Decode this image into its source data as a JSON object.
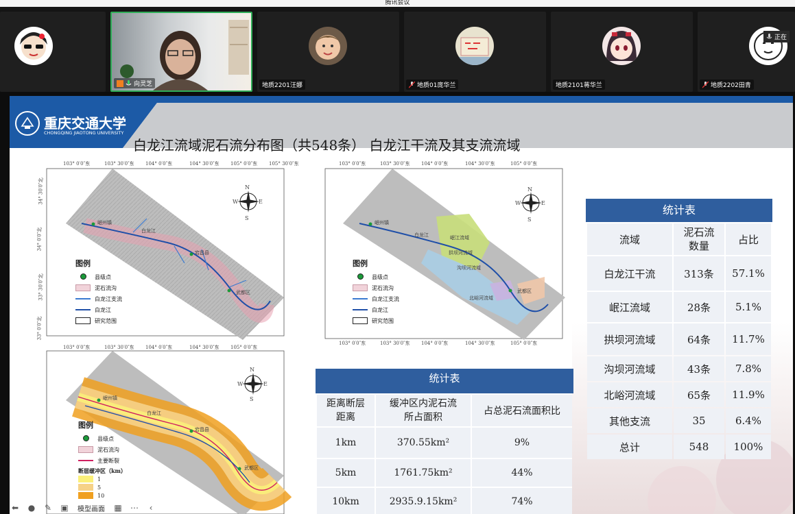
{
  "window": {
    "title": "腾讯会议"
  },
  "participants": [
    {
      "name": "",
      "muted": false,
      "active": false,
      "avatar": "cartoon-sunglasses"
    },
    {
      "name": "向灵芝",
      "muted": false,
      "active": true,
      "avatar": "camera-video"
    },
    {
      "name": "地质2201汪娜",
      "muted": false,
      "active": false,
      "avatar": "baby-photo"
    },
    {
      "name": "地质01庞华兰",
      "muted": true,
      "active": false,
      "avatar": "photo-sign"
    },
    {
      "name": "地质2101蒋华兰",
      "muted": false,
      "active": false,
      "avatar": "anime-girl"
    },
    {
      "name": "地质2202田青",
      "muted": true,
      "active": false,
      "avatar": "mic-cartoon"
    }
  ],
  "status_badge": "正在",
  "slide": {
    "logo_cn": "重庆交通大学",
    "logo_en": "CHONGQING JIAOTONG UNIVERSITY",
    "title": "白龙江流域泥石流分布图（共548条） 白龙江干流及其支流流域",
    "map_top_coords": [
      "103° 0′0″东",
      "103° 30′0″东",
      "104° 0′0″东",
      "104° 30′0″东",
      "105° 0′0″东",
      "105° 30′0″东"
    ],
    "map_side_coords": [
      "34° 30′0″北",
      "34° 0′0″北",
      "33° 30′0″北",
      "33° 0′0″北"
    ],
    "compass": {
      "n": "N",
      "s": "S",
      "e": "E",
      "w": "W"
    },
    "town_labels": [
      "岷州镇",
      "白龙江",
      "宕昌县",
      "武都区"
    ],
    "basin_labels": [
      "岷江流域",
      "拱坝河流域",
      "沟坝河流域",
      "北峪河流域"
    ],
    "legend1": {
      "title": "图例",
      "items": [
        "县级点",
        "泥石流沟",
        "白龙江支流",
        "白龙江",
        "研究范围"
      ]
    },
    "legend2": {
      "title": "图例",
      "items": [
        "县级点",
        "泥石流沟",
        "主要断裂"
      ],
      "buffer_title": "断层缓冲区（km）",
      "buffer_items": [
        "1",
        "5",
        "10"
      ]
    },
    "table_right": {
      "title": "统计表",
      "headers": [
        "流域",
        "泥石流\n数量",
        "占比"
      ],
      "rows": [
        [
          "白龙江干流",
          "313条",
          "57.1%"
        ],
        [
          "岷江流域",
          "28条",
          "5.1%"
        ],
        [
          "拱坝河流域",
          "64条",
          "11.7%"
        ],
        [
          "沟坝河流域",
          "43条",
          "7.8%"
        ],
        [
          "北峪河流域",
          "65条",
          "11.9%"
        ],
        [
          "其他支流",
          "35",
          "6.4%"
        ],
        [
          "总计",
          "548",
          "100%"
        ]
      ]
    },
    "table_bottom": {
      "title": "统计表",
      "headers": [
        "距离断层\n距离",
        "缓冲区内泥石流\n所占面积",
        "占总泥石流面积比"
      ],
      "rows": [
        [
          "1km",
          "370.55km²",
          "9%"
        ],
        [
          "5km",
          "1761.75km²",
          "44%"
        ],
        [
          "10km",
          "2935.9.15km²",
          "74%"
        ]
      ]
    }
  },
  "toolbar": {
    "label": "模型画面"
  },
  "colors": {
    "accent_blue": "#2f5e9e",
    "active_green": "#2fae58",
    "header_blue": "#1c5aa6"
  }
}
